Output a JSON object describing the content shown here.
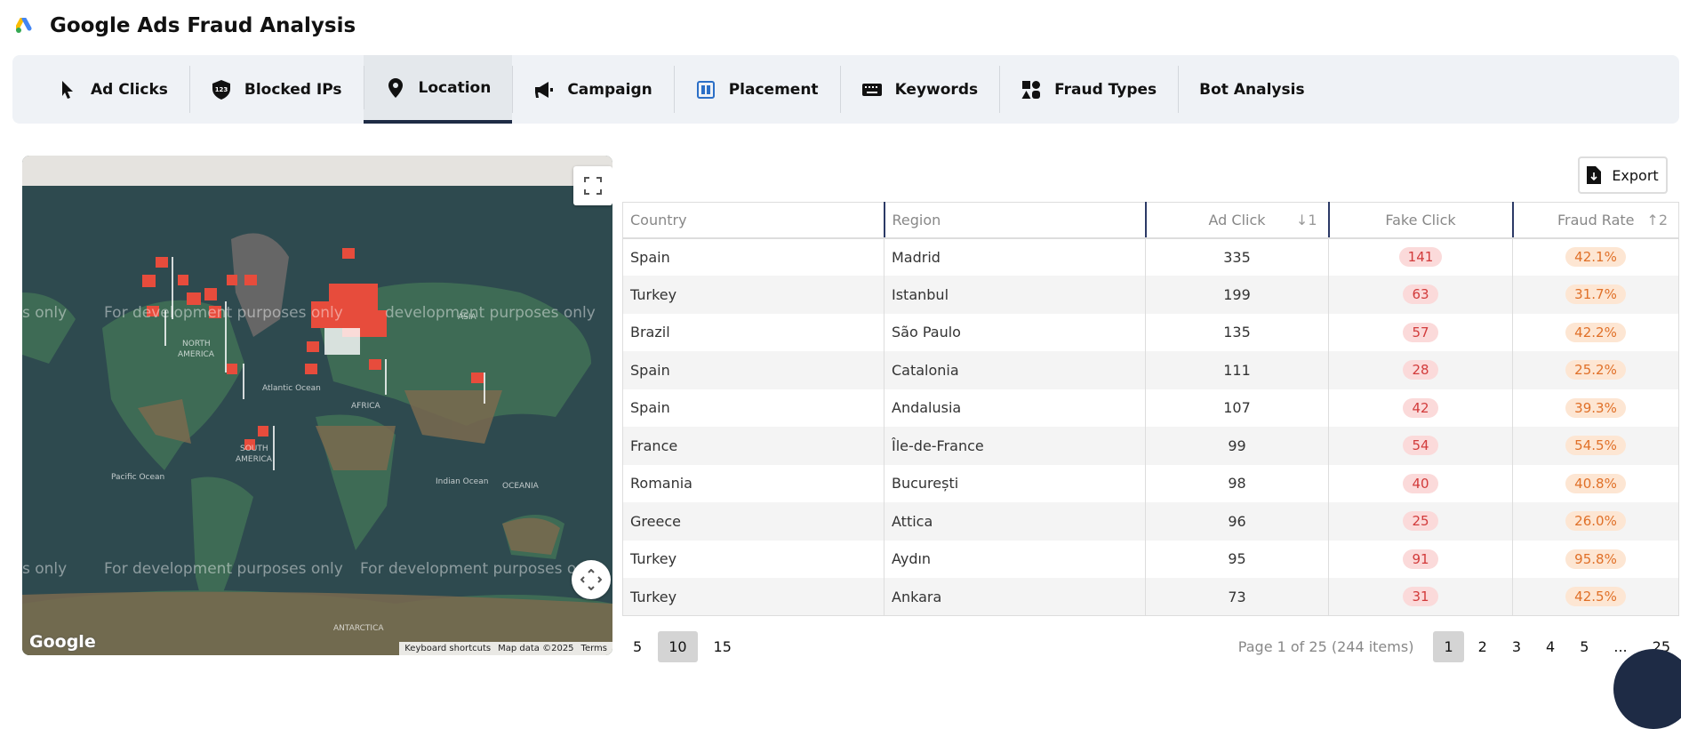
{
  "app": {
    "title": "Google Ads Fraud Analysis",
    "logo": "google-ads-logo"
  },
  "tabs": [
    {
      "label": "Ad Clicks",
      "icon": "cursor-icon"
    },
    {
      "label": "Blocked IPs",
      "icon": "shield-123-icon"
    },
    {
      "label": "Location",
      "icon": "map-pin-icon",
      "active": true
    },
    {
      "label": "Campaign",
      "icon": "megaphone-icon"
    },
    {
      "label": "Placement",
      "icon": "placement-icon"
    },
    {
      "label": "Keywords",
      "icon": "keyboard-icon"
    },
    {
      "label": "Fraud Types",
      "icon": "shapes-icon"
    },
    {
      "label": "Bot Analysis"
    }
  ],
  "map": {
    "watermark": "For development purposes only",
    "watermark_partial": "s only",
    "watermark_partial2": "development purposes only",
    "labels": {
      "na1": "NORTH",
      "na2": "AMERICA",
      "sa1": "SOUTH",
      "sa2": "AMERICA",
      "asia": "ASIA",
      "africa": "AFRICA",
      "oceania": "OCEANIA",
      "antarctica": "ANTARCTICA",
      "atlantic": "Atlantic Ocean",
      "pacific": "Pacific Ocean",
      "indian": "Indian Ocean"
    },
    "logo": "Google",
    "attribution": {
      "shortcuts": "Keyboard shortcuts",
      "data": "Map data ©2025",
      "terms": "Terms"
    },
    "marker_color": "#e74c3c"
  },
  "export_label": "Export",
  "table": {
    "columns": [
      "Country",
      "Region",
      "Ad Click",
      "Fake Click",
      "Fraud Rate"
    ],
    "sort": {
      "ad_click": "↓1",
      "fraud_rate": "↑2"
    },
    "rows": [
      [
        "Spain",
        "Madrid",
        "335",
        "141",
        "42.1%"
      ],
      [
        "Turkey",
        "Istanbul",
        "199",
        "63",
        "31.7%"
      ],
      [
        "Brazil",
        "São Paulo",
        "135",
        "57",
        "42.2%"
      ],
      [
        "Spain",
        "Catalonia",
        "111",
        "28",
        "25.2%"
      ],
      [
        "Spain",
        "Andalusia",
        "107",
        "42",
        "39.3%"
      ],
      [
        "France",
        "Île-de-France",
        "99",
        "54",
        "54.5%"
      ],
      [
        "Romania",
        "București",
        "98",
        "40",
        "40.8%"
      ],
      [
        "Greece",
        "Attica",
        "96",
        "25",
        "26.0%"
      ],
      [
        "Turkey",
        "Aydın",
        "95",
        "91",
        "95.8%"
      ],
      [
        "Turkey",
        "Ankara",
        "73",
        "31",
        "42.5%"
      ]
    ]
  },
  "page_sizes": [
    "5",
    "10",
    "15"
  ],
  "selected_page_size": "10",
  "pagination": {
    "info": "Page 1 of 25 (244 items)",
    "pages": [
      "1",
      "2",
      "3",
      "4",
      "5"
    ],
    "ellipsis": "...",
    "last": "25",
    "current": "1"
  }
}
